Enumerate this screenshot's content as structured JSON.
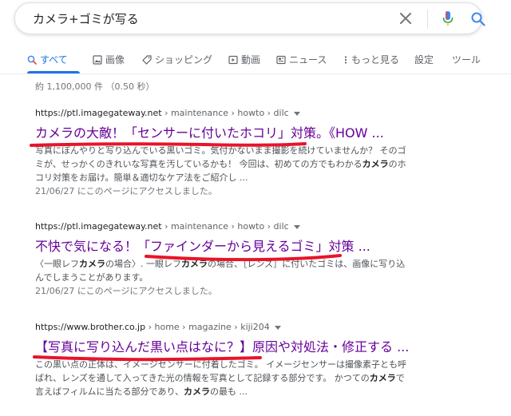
{
  "search": {
    "query": "カメラ+ゴミが写る"
  },
  "tabs": [
    {
      "label": "すべて"
    },
    {
      "label": "画像"
    },
    {
      "label": "ショッピング"
    },
    {
      "label": "動画"
    },
    {
      "label": "ニュース"
    },
    {
      "label": "もっと見る"
    },
    {
      "label": "設定"
    },
    {
      "label": "ツール"
    }
  ],
  "stats": "約 1,100,000 件 （0.50 秒）",
  "results": [
    {
      "cite_domain": "https://ptl.imagegateway.net",
      "cite_path": " › maintenance › howto › dilc",
      "title": "カメラの大敵！「センサーに付いたホコリ」対策。《HOW ...",
      "snippet_1": "写真にぼんやりと写り込んでいる黒いゴミ。気付かないまま撮影を続けていませんか？ そのゴ",
      "snippet_2": "ミが、せっかくのきれいな写真を汚しているかも！ 今回は、初めての方でもわかる",
      "snippet_2b": "カメラ",
      "snippet_2c": "のホ",
      "snippet_3": "コリ対策をお届け。簡単＆適切なケア法をご紹介し ...",
      "date": "21/06/27 にこのページにアクセスしました。"
    },
    {
      "cite_domain": "https://ptl.imagegateway.net",
      "cite_path": " › maintenance › howto › dilc",
      "title": "不快で気になる！「ファインダーから見えるゴミ」対策 ...",
      "snippet_1a": "〈一眼レフ",
      "snippet_1b": "カメラ",
      "snippet_1c": "の場合〉. 一眼レフ",
      "snippet_1d": "カメラ",
      "snippet_1e": "の場合、［レンズ］に付いたゴミは、画像に写り込",
      "snippet_2": "んでしまうことがあります。",
      "date": "21/06/27 にこのページにアクセスしました。"
    },
    {
      "cite_domain": "https://www.brother.co.jp",
      "cite_path": " › home › magazine › kiji204",
      "title": "【写真に写り込んだ黒い点はなに？】原因や対処法・修正する ...",
      "snippet_1": "この黒い点の正体は、イメージセンサーに付着したゴミ。 イメージセンサーは撮像素子とも呼",
      "snippet_2a": "ばれ、レンズを通して入ってきた光の情報を写真として記録する部分です。 かつての",
      "snippet_2b": "カメラ",
      "snippet_2c": "で",
      "snippet_3a": "言えばフィルムに当たる部分であり、",
      "snippet_3b": "カメラ",
      "snippet_3c": "の最も ..."
    }
  ],
  "colors": {
    "link_visited": "#660099",
    "accent": "#1a73e8",
    "annotation": "#e8142a"
  },
  "icons": [
    "clear-icon",
    "mic-icon",
    "search-icon",
    "search-small-icon",
    "image-icon",
    "tag-icon",
    "video-icon",
    "news-icon",
    "more-dots-icon",
    "caret-down-icon"
  ]
}
